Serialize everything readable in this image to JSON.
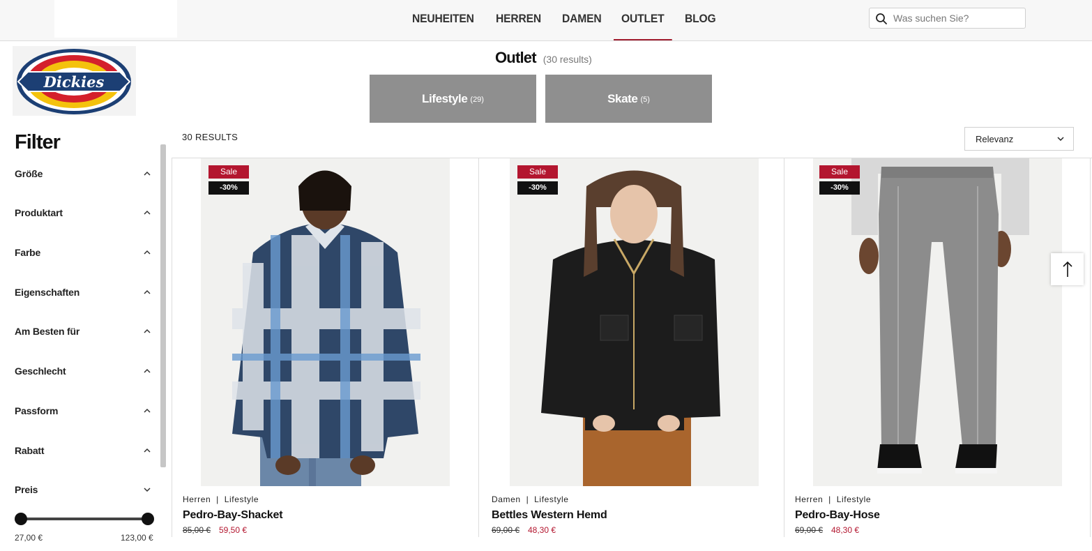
{
  "header": {
    "nav": [
      {
        "label": "NEUHEITEN"
      },
      {
        "label": "HERREN"
      },
      {
        "label": "DAMEN"
      },
      {
        "label": "OUTLET"
      },
      {
        "label": "BLOG"
      }
    ],
    "active_nav": "OUTLET",
    "search": {
      "placeholder": "Was suchen Sie?"
    }
  },
  "brand": {
    "logo_text": "Dickies"
  },
  "page": {
    "title": "Outlet",
    "count": "(30 results)"
  },
  "categories": [
    {
      "label": "Lifestyle",
      "count": "(29)"
    },
    {
      "label": "Skate",
      "count": "(5)"
    }
  ],
  "sidebar": {
    "title": "Filter",
    "facets": [
      {
        "label": "Größe",
        "state": "collapsed"
      },
      {
        "label": "Produktart",
        "state": "collapsed"
      },
      {
        "label": "Farbe",
        "state": "collapsed"
      },
      {
        "label": "Eigenschaften",
        "state": "collapsed"
      },
      {
        "label": "Am Besten für",
        "state": "collapsed"
      },
      {
        "label": "Geschlecht",
        "state": "collapsed"
      },
      {
        "label": "Passform",
        "state": "collapsed"
      },
      {
        "label": "Rabatt",
        "state": "collapsed"
      },
      {
        "label": "Preis",
        "state": "expanded"
      }
    ],
    "price_range": {
      "min": "27,00 €",
      "max": "123,00 €"
    }
  },
  "results": {
    "count": "30",
    "label": "RESULTS"
  },
  "sort": {
    "selected": "Relevanz"
  },
  "products": [
    {
      "badge_sale": "Sale",
      "badge_discount": "-30%",
      "gender": "Herren",
      "category": "Lifestyle",
      "separator": "|",
      "name": "Pedro-Bay-Shacket",
      "price_old": "85,00 €",
      "price_new": "59,50 €"
    },
    {
      "badge_sale": "Sale",
      "badge_discount": "-30%",
      "gender": "Damen",
      "category": "Lifestyle",
      "separator": "|",
      "name": "Bettles Western Hemd",
      "price_old": "69,00 €",
      "price_new": "48,30 €"
    },
    {
      "badge_sale": "Sale",
      "badge_discount": "-30%",
      "gender": "Herren",
      "category": "Lifestyle",
      "separator": "|",
      "name": "Pedro-Bay-Hose",
      "price_old": "69,00 €",
      "price_new": "48,30 €"
    }
  ],
  "colors": {
    "accent": "#b3162f",
    "category_button": "#8f8f8f",
    "badge_dark": "#111111"
  },
  "icons": {
    "search": "search-icon",
    "facet_toggle": "chevron-icon",
    "sort": "chevron-down-icon",
    "back_to_top": "arrow-up-icon"
  }
}
